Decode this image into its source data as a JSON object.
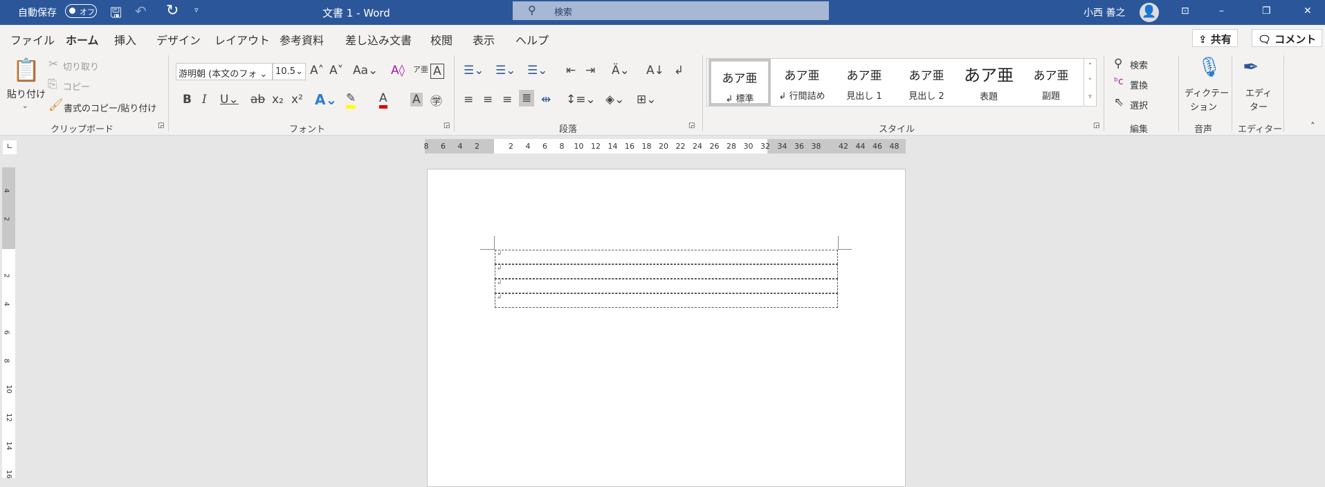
{
  "titlebar": {
    "autosave_label": "自動保存",
    "autosave_state": "オフ",
    "doc_title": "文書 1  -  Word",
    "search_placeholder": "検索",
    "user_name": "小西 善之"
  },
  "tabs": [
    "ファイル",
    "ホーム",
    "挿入",
    "デザイン",
    "レイアウト",
    "参考資料",
    "差し込み文書",
    "校閲",
    "表示",
    "ヘルプ"
  ],
  "active_tab": "ホーム",
  "share_label": "共有",
  "comment_label": "コメント",
  "clipboard": {
    "paste": "貼り付け",
    "cut": "切り取り",
    "copy": "コピー",
    "format_painter": "書式のコピー/貼り付け",
    "label": "クリップボード"
  },
  "font": {
    "name": "游明朝 (本文のフォ",
    "size": "10.5",
    "label": "フォント",
    "highlight_color": "#ffff00",
    "font_color": "#e00000"
  },
  "paragraph": {
    "label": "段落"
  },
  "styles": {
    "label": "スタイル",
    "items": [
      {
        "preview": "あア亜",
        "name": "↲ 標準"
      },
      {
        "preview": "あア亜",
        "name": "↲ 行間詰め"
      },
      {
        "preview": "あア亜",
        "name": "見出し 1"
      },
      {
        "preview": "あア亜",
        "name": "見出し 2"
      },
      {
        "preview": "あア亜",
        "name": "表題"
      },
      {
        "preview": "あア亜",
        "name": "副題"
      }
    ]
  },
  "editing": {
    "find": "検索",
    "replace": "置換",
    "select": "選択",
    "label": "編集"
  },
  "voice": {
    "dictate": "ディクテー",
    "dictate2": "ション",
    "label": "音声"
  },
  "editor": {
    "button": "エディ",
    "button2": "ター",
    "label": "エディター"
  },
  "ruler": {
    "left": [
      "8",
      "6",
      "4",
      "2"
    ],
    "main": [
      "2",
      "4",
      "6",
      "8",
      "10",
      "12",
      "14",
      "16",
      "18",
      "20",
      "22",
      "24",
      "26",
      "28",
      "30",
      "32",
      "34",
      "36",
      "38"
    ],
    "right": [
      "42",
      "44",
      "46",
      "48"
    ],
    "vertical": [
      "4",
      "2",
      "",
      "2",
      "4",
      "6",
      "8",
      "10",
      "12",
      "14",
      "16"
    ]
  },
  "table": {
    "rows": 4,
    "mark": "↲"
  }
}
